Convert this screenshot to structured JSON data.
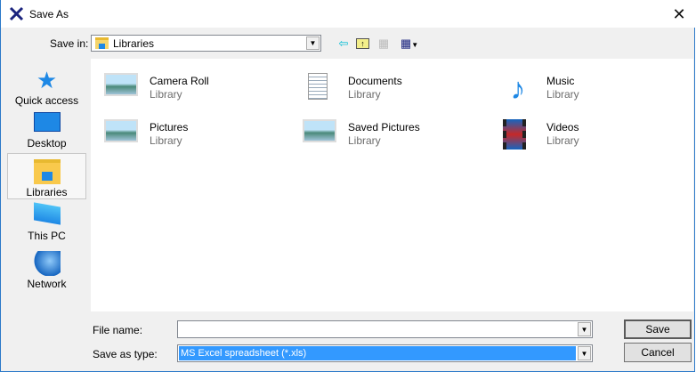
{
  "window": {
    "title": "Save As"
  },
  "toolbar": {
    "save_in_label": "Save in:",
    "save_in_value": "Libraries"
  },
  "sidebar": {
    "items": [
      {
        "label": "Quick access"
      },
      {
        "label": "Desktop"
      },
      {
        "label": "Libraries",
        "selected": true
      },
      {
        "label": "This PC"
      },
      {
        "label": "Network"
      }
    ]
  },
  "files": [
    {
      "name": "Camera Roll",
      "type": "Library",
      "icon": "pictures-library-icon"
    },
    {
      "name": "Documents",
      "type": "Library",
      "icon": "documents-library-icon"
    },
    {
      "name": "Music",
      "type": "Library",
      "icon": "music-library-icon"
    },
    {
      "name": "Pictures",
      "type": "Library",
      "icon": "pictures-library-icon"
    },
    {
      "name": "Saved Pictures",
      "type": "Library",
      "icon": "pictures-library-icon"
    },
    {
      "name": "Videos",
      "type": "Library",
      "icon": "videos-library-icon"
    }
  ],
  "footer": {
    "file_name_label": "File name:",
    "file_name_value": "",
    "save_type_label": "Save as type:",
    "save_type_value": "MS Excel spreadsheet (*.xls)",
    "save_label": "Save",
    "cancel_label": "Cancel"
  }
}
